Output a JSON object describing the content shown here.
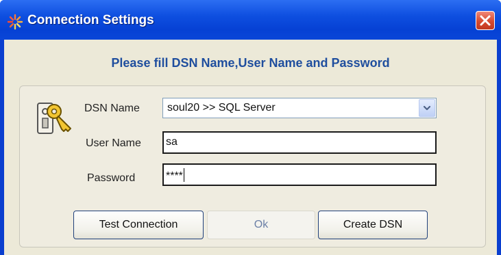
{
  "window": {
    "title": "Connection Settings",
    "title_icon": "sparkle-icon",
    "close_icon": "close-icon"
  },
  "form": {
    "heading": "Please fill DSN Name,User Name and Password",
    "icon": "keys-icon",
    "dsn_label": "DSN Name",
    "dsn_value": "soul20 >> SQL Server",
    "user_label": "User Name",
    "user_value": "sa",
    "password_label": "Password",
    "password_value": "****"
  },
  "buttons": {
    "test": "Test Connection",
    "ok": "Ok",
    "create": "Create DSN"
  },
  "colors": {
    "titlebar": "#0a46d8",
    "heading": "#1f4e9e",
    "close": "#d64a2f",
    "client_bg": "#ece9d8"
  }
}
